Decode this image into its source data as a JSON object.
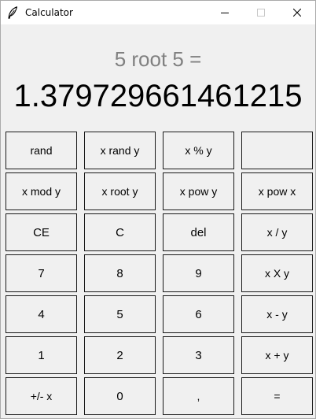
{
  "window": {
    "title": "Calculator",
    "icon": "feather-icon",
    "controls": [
      "minimize-icon",
      "maximize-icon",
      "close-icon"
    ]
  },
  "display": {
    "expression": "5 root 5 =",
    "result": "1.379729661461215"
  },
  "keys": [
    [
      "rand",
      "x rand y",
      "x % y",
      ""
    ],
    [
      "x mod y",
      "x root y",
      "x pow y",
      "x pow x"
    ],
    [
      "CE",
      "C",
      "del",
      "x / y"
    ],
    [
      "7",
      "8",
      "9",
      "x X y"
    ],
    [
      "4",
      "5",
      "6",
      "x - y"
    ],
    [
      "1",
      "2",
      "3",
      "x + y"
    ],
    [
      "+/- x",
      "0",
      ",",
      "="
    ]
  ],
  "colors": {
    "window_background": "#f0f0f0",
    "titlebar_background": "#ffffff",
    "expression_text": "#808080",
    "result_text": "#000000",
    "key_border": "#1a1a1a"
  }
}
